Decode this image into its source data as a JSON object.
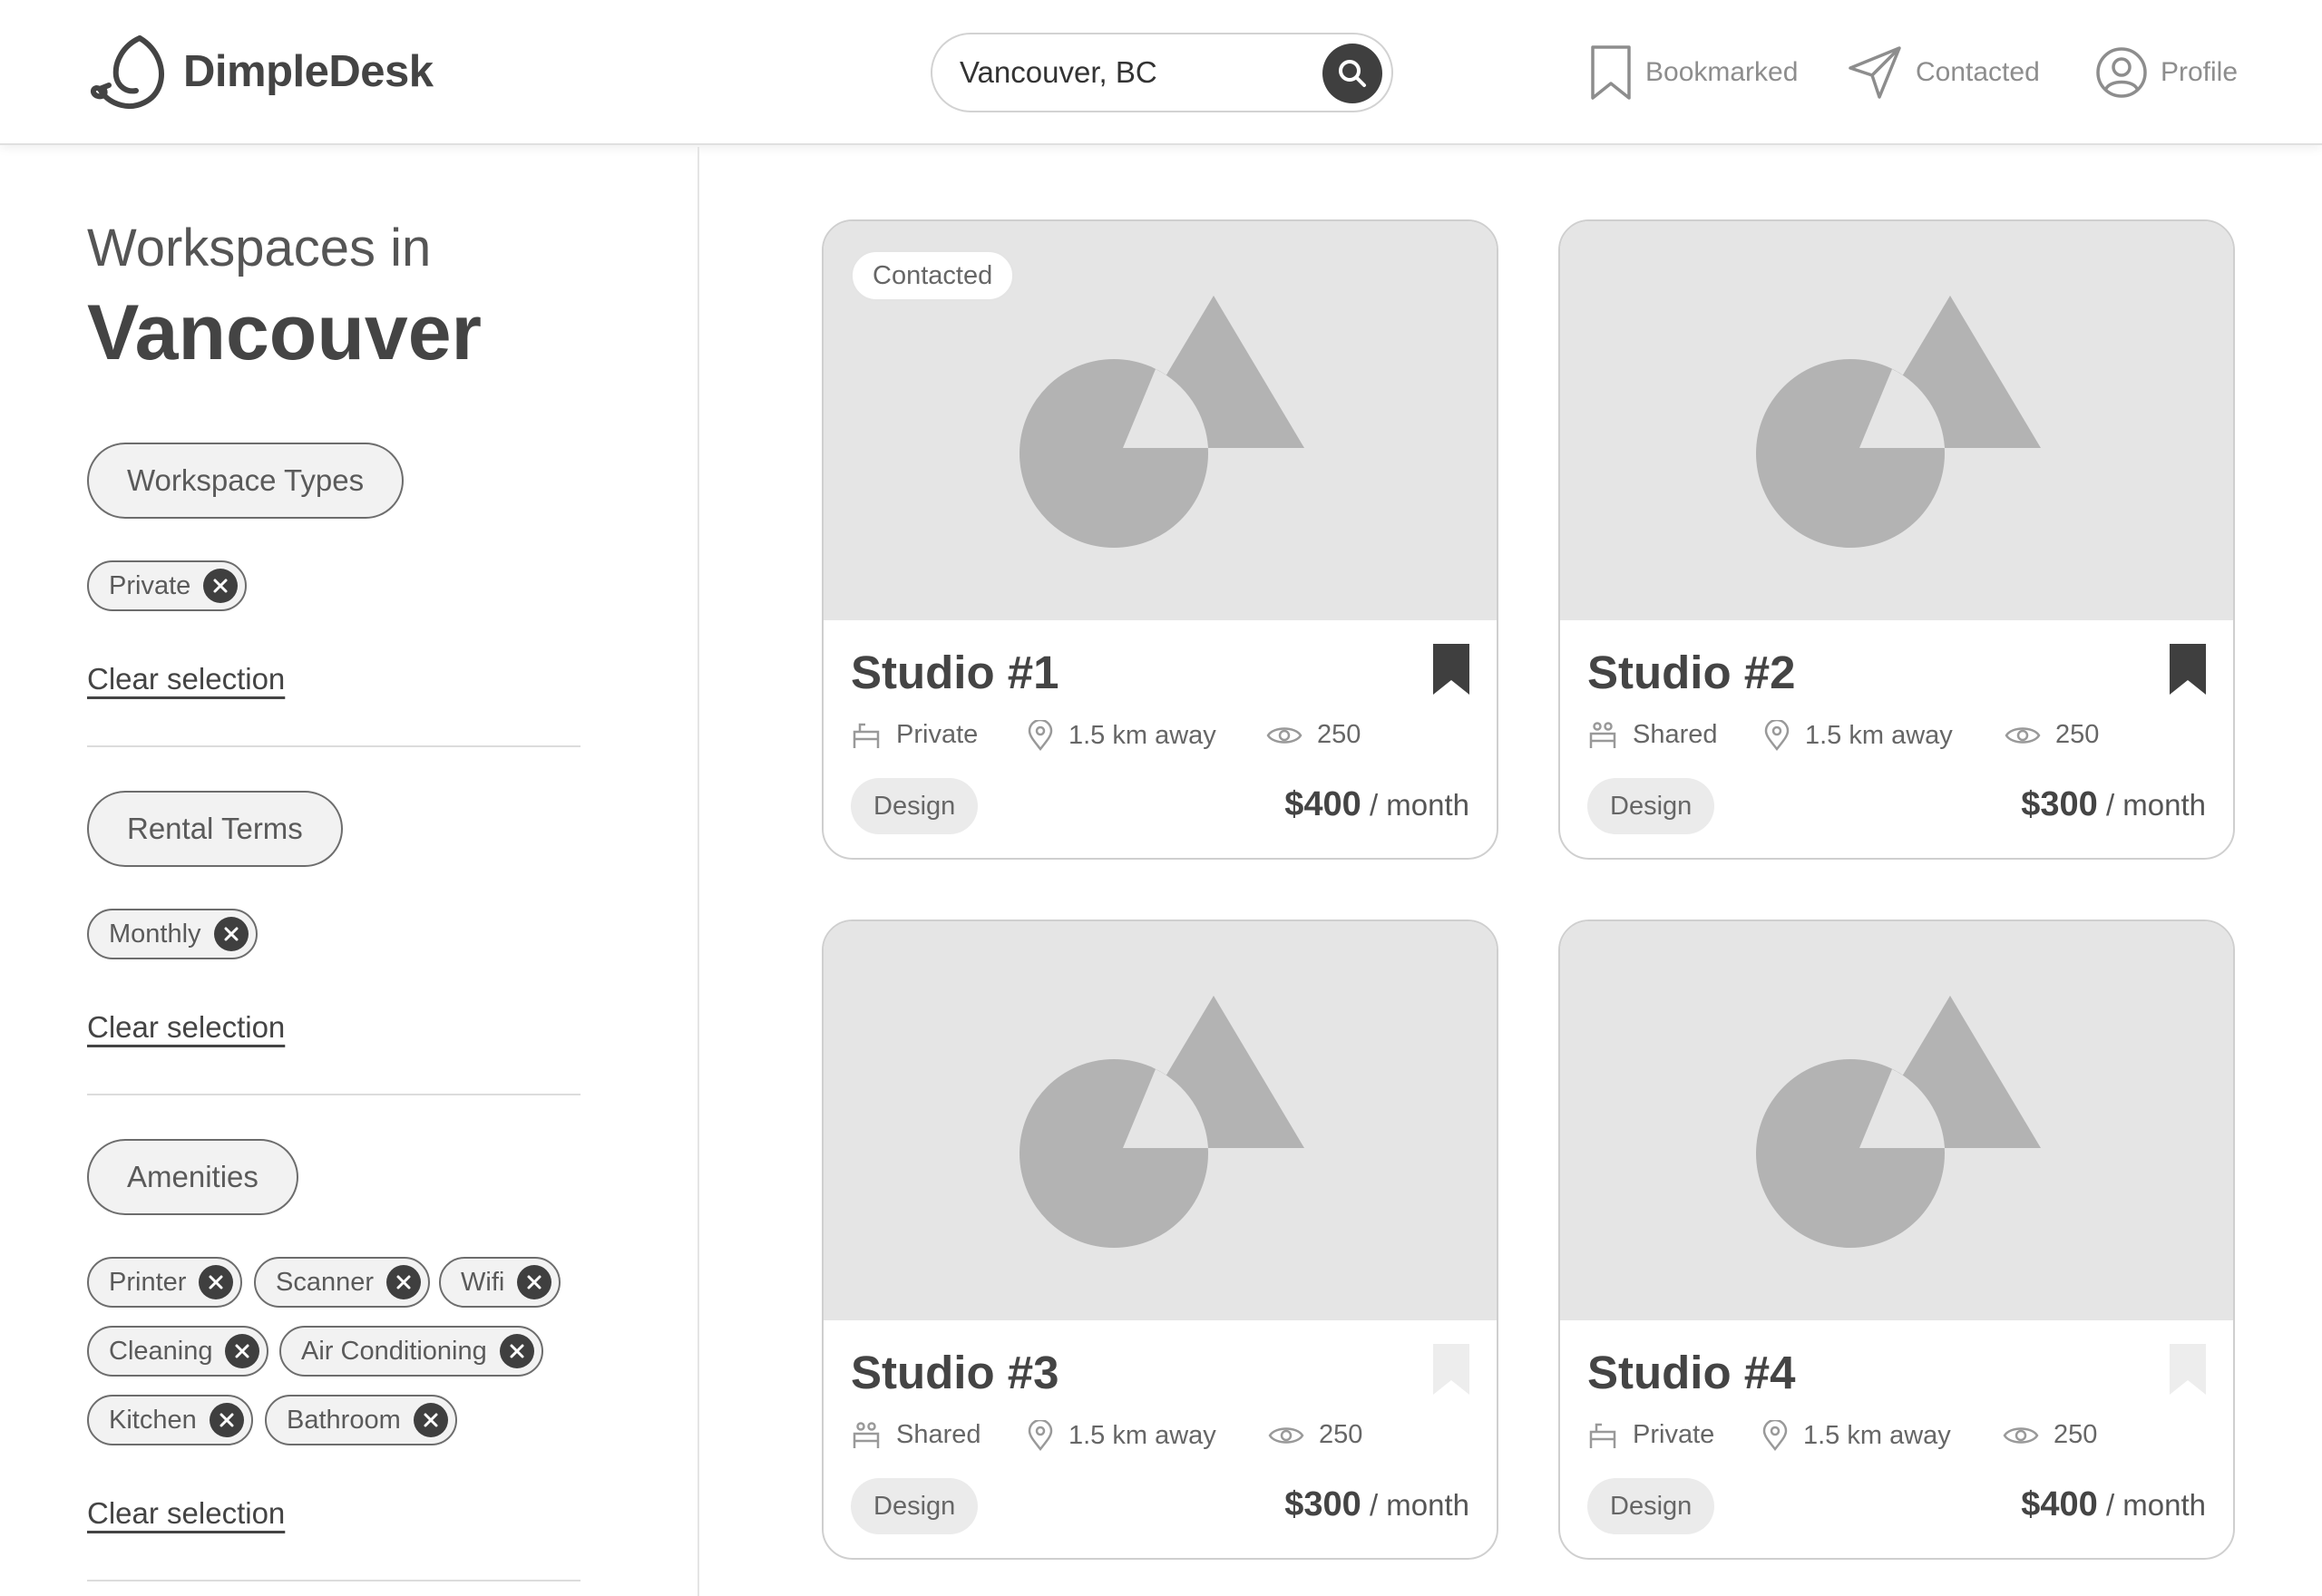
{
  "header": {
    "brand": "DimpleDesk",
    "search": {
      "value": "Vancouver, BC"
    },
    "nav": [
      {
        "label": "Bookmarked",
        "icon": "bookmark-icon"
      },
      {
        "label": "Contacted",
        "icon": "paper-plane-icon"
      },
      {
        "label": "Profile",
        "icon": "user-circle-icon"
      }
    ]
  },
  "sidebar": {
    "title_small": "Workspaces in",
    "title_big": "Vancouver",
    "clear_label": "Clear selection",
    "filters": [
      {
        "label": "Workspace Types",
        "chips": [
          "Private"
        ]
      },
      {
        "label": "Rental Terms",
        "chips": [
          "Monthly"
        ]
      },
      {
        "label": "Amenities",
        "chips": [
          "Printer",
          "Scanner",
          "Wifi",
          "Cleaning",
          "Air Conditioning",
          "Kitchen",
          "Bathroom"
        ]
      }
    ]
  },
  "listings": [
    {
      "title": "Studio #1",
      "badge": "Contacted",
      "type": "Private",
      "distance": "1.5 km away",
      "views": "250",
      "tag": "Design",
      "price": "$400",
      "period": "/ month",
      "bookmarked": true
    },
    {
      "title": "Studio #2",
      "badge": "",
      "type": "Shared",
      "distance": "1.5 km away",
      "views": "250",
      "tag": "Design",
      "price": "$300",
      "period": "/ month",
      "bookmarked": true
    },
    {
      "title": "Studio #3",
      "badge": "",
      "type": "Shared",
      "distance": "1.5 km away",
      "views": "250",
      "tag": "Design",
      "price": "$300",
      "period": "/ month",
      "bookmarked": false
    },
    {
      "title": "Studio #4",
      "badge": "",
      "type": "Private",
      "distance": "1.5 km away",
      "views": "250",
      "tag": "Design",
      "price": "$400",
      "period": "/ month",
      "bookmarked": false
    }
  ],
  "colors": {
    "accent_dark": "#3f3f3f",
    "bookmark_inactive": "#ededed",
    "image_placeholder": "#e5e5e5"
  }
}
